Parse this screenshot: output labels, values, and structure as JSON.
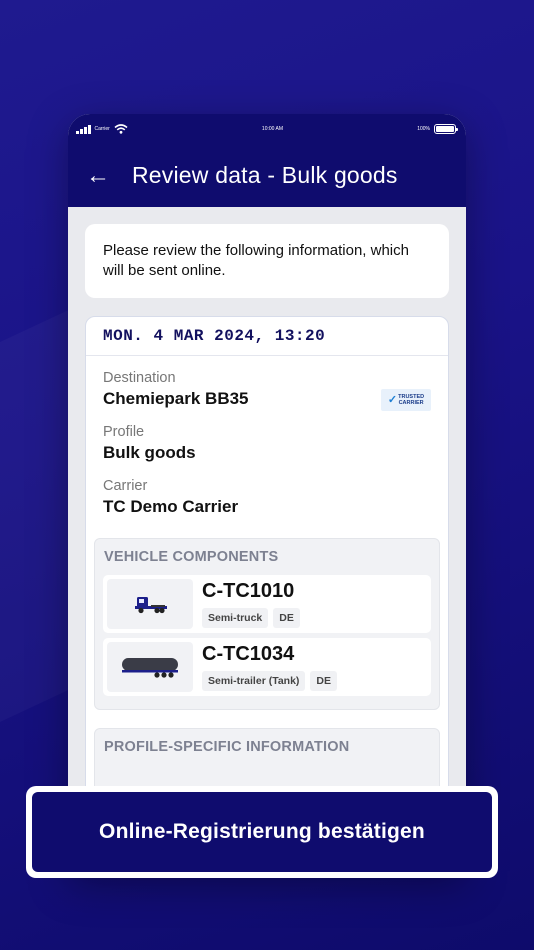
{
  "status_bar": {
    "carrier": "Carrier",
    "time": "10:00 AM",
    "battery": "100%"
  },
  "app_bar": {
    "title": "Review data - Bulk goods"
  },
  "notice": {
    "text": "Please review the following information, which will be sent online."
  },
  "booking": {
    "datetime": "MON. 4 MAR 2024, 13:20",
    "fields": [
      {
        "label": "Destination",
        "value": "Chemiepark BB35"
      },
      {
        "label": "Profile",
        "value": "Bulk goods"
      },
      {
        "label": "Carrier",
        "value": "TC Demo Carrier"
      }
    ],
    "badge": {
      "line1": "TRUSTED",
      "line2": "CARRIER",
      "icon": "checkmark-v-icon"
    }
  },
  "vehicle_components": {
    "title": "VEHICLE COMPONENTS",
    "items": [
      {
        "id": "C-TC1010",
        "type": "Semi-truck",
        "country": "DE",
        "icon": "semi-truck-icon"
      },
      {
        "id": "C-TC1034",
        "type": "Semi-trailer (Tank)",
        "country": "DE",
        "icon": "tank-trailer-icon"
      }
    ]
  },
  "profile_specific": {
    "title": "PROFILE-SPECIFIC INFORMATION"
  },
  "confirm": {
    "label": "Online-Registrierung bestätigen"
  },
  "colors": {
    "primary": "#0f0c6e",
    "background": "#1a1388",
    "date_text": "#12105e"
  }
}
